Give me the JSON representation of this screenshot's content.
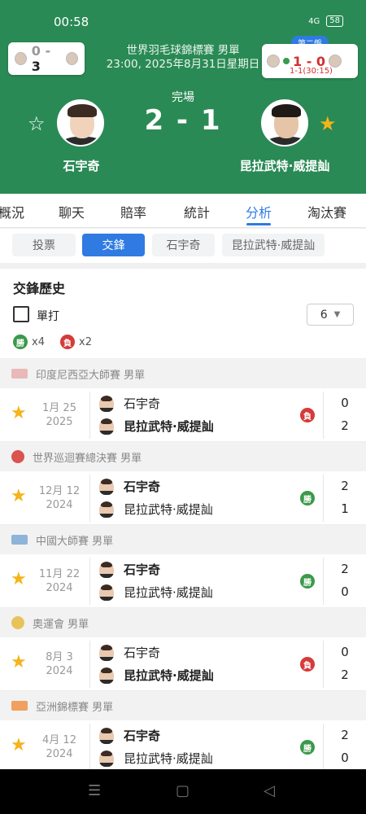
{
  "status_bar": {
    "time": "00:58",
    "signal": "4G",
    "battery": "58"
  },
  "header": {
    "tournament": "世界羽毛球錦標賽 男單",
    "datetime": "23:00, 2025年8月31日星期日",
    "status": "完場",
    "score": "2 - 1",
    "home_name": "石宇奇",
    "away_name": "昆拉武特·威提訕",
    "left_card": {
      "home_score": "0",
      "away_score": "3",
      "separator": "-"
    },
    "right_card": {
      "round": "第二盤",
      "score": "1 - 0",
      "sub": "1-1(30:15)"
    },
    "accent": "#2a8a55"
  },
  "tabs": {
    "items": [
      "概況",
      "聊天",
      "賠率",
      "統計",
      "分析",
      "淘汰賽"
    ],
    "active": "分析"
  },
  "segments": {
    "items": [
      "投票",
      "交鋒",
      "石宇奇",
      "昆拉武特·威提訕"
    ],
    "active": "交鋒"
  },
  "h2h": {
    "title": "交鋒歷史",
    "single_label": "單打",
    "count": "6",
    "win_badge": "勝",
    "win_count": "x4",
    "loss_badge": "負",
    "loss_count": "x2"
  },
  "matches": [
    {
      "event": "印度尼西亞大師賽 男單",
      "date": "1月 25",
      "year": "2025",
      "p1": "石宇奇",
      "p2": "昆拉武特·威提訕",
      "s1": "0",
      "s2": "2",
      "result": "負",
      "winner": 2
    },
    {
      "event": "世界巡迴賽總決賽 男單",
      "date": "12月 12",
      "year": "2024",
      "p1": "石宇奇",
      "p2": "昆拉武特·威提訕",
      "s1": "2",
      "s2": "1",
      "result": "勝",
      "winner": 1
    },
    {
      "event": "中國大師賽 男單",
      "date": "11月 22",
      "year": "2024",
      "p1": "石宇奇",
      "p2": "昆拉武特·威提訕",
      "s1": "2",
      "s2": "0",
      "result": "勝",
      "winner": 1
    },
    {
      "event": "奧運會 男單",
      "date": "8月 3",
      "year": "2024",
      "p1": "石宇奇",
      "p2": "昆拉武特·威提訕",
      "s1": "0",
      "s2": "2",
      "result": "負",
      "winner": 2
    },
    {
      "event": "亞洲錦標賽 男單",
      "date": "4月 12",
      "year": "2024",
      "p1": "石宇奇",
      "p2": "昆拉武特·威提訕",
      "s1": "2",
      "s2": "0",
      "result": "勝",
      "winner": 1
    }
  ],
  "colors": {
    "win": "#3a9a4a",
    "loss": "#d63a3a",
    "active": "#2f7be2",
    "star": "#f4b41a"
  }
}
